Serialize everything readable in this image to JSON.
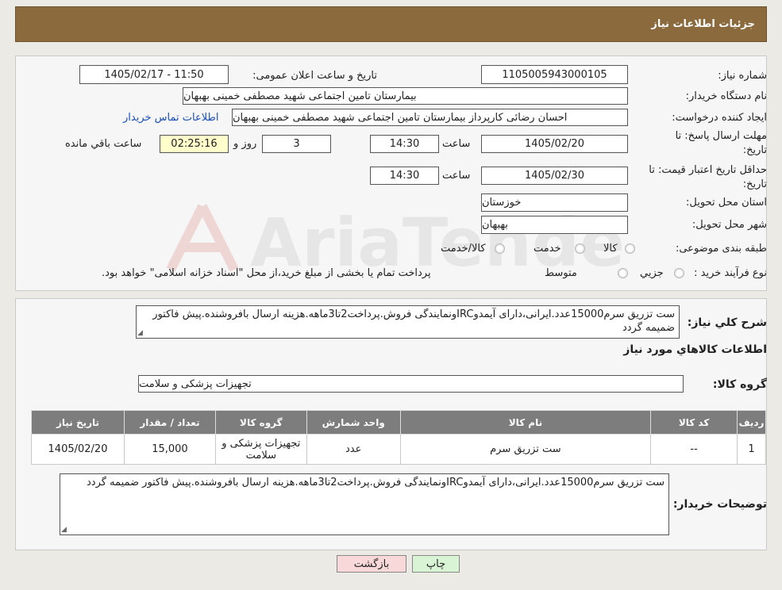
{
  "header": {
    "title": "جزئیات اطلاعات نیاز"
  },
  "form": {
    "need_number_label": "شماره نیاز:",
    "need_number": "1105005943000105",
    "announce_label": "تاریخ و ساعت اعلان عمومی:",
    "announce_value": "1405/02/17 - 11:50",
    "buyer_org_label": "نام دستگاه خریدار:",
    "buyer_org": "بیمارستان تامین اجتماعی شهید مصطفی خمینی بهبهان",
    "creator_label": "ایجاد کننده درخواست:",
    "creator": "احسان رضائی کارپرداز بیمارستان تامین اجتماعی شهید مصطفی خمینی بهبهان",
    "contact_link": "اطلاعات تماس خریدار",
    "deadline_label_1": "مهلت ارسال پاسخ: تا",
    "deadline_label_2": "تاریخ:",
    "deadline_date": "1405/02/20",
    "time_label": "ساعت",
    "deadline_time": "14:30",
    "days_value": "3",
    "days_label": "روز و",
    "remaining_time": "02:25:16",
    "remaining_label": "ساعت باقي مانده",
    "validity_label_1": "حداقل تاریخ اعتبار قیمت: تا",
    "validity_label_2": "تاریخ:",
    "validity_date": "1405/02/30",
    "validity_time": "14:30",
    "province_label": "استان محل تحویل:",
    "province": "خوزستان",
    "city_label": "شهر محل تحویل:",
    "city": "بهبهان",
    "category_label": "طبقه بندی موضوعی:",
    "category_options": [
      "کالا",
      "خدمت",
      "کالا/خدمت"
    ],
    "process_label": "نوع فرآیند خرید :",
    "process_options": [
      "جزیي",
      "متوسط"
    ],
    "process_note": "پرداخت تمام یا بخشی از مبلغ خرید،از محل \"اسناد خزانه اسلامی\" خواهد بود."
  },
  "summary": {
    "label": "شرح کلي نیاز:",
    "text": "ست تزریق سرم15000عدد.ایرانی،دارای آیمدوIRCونمایندگی فروش.پرداخت2تا3ماهه.هزینه ارسال بافروشنده.پیش فاکتور ضمیمه گردد",
    "items_title": "اطلاعات کالاهاي مورد نیاز",
    "group_label": "گروه کالا:",
    "group_value": "تجهیزات پزشکی و سلامت"
  },
  "table": {
    "headers": [
      "ردیف",
      "کد کالا",
      "نام کالا",
      "واحد شمارش",
      "گروه کالا",
      "تعداد / مقدار",
      "تاریخ نیاز"
    ],
    "rows": [
      [
        "1",
        "--",
        "ست تزریق سرم",
        "عدد",
        "تجهیزات پزشکی و سلامت",
        "15,000",
        "1405/02/20"
      ]
    ]
  },
  "buyer_notes": {
    "label": "توضیحات خریدار:",
    "text": "ست تزریق سرم15000عدد.ایرانی،دارای آیمدوIRCونمایندگی فروش.پرداخت2تا3ماهه.هزینه ارسال بافروشنده.پیش فاکتور ضمیمه گردد"
  },
  "buttons": {
    "print": "چاپ",
    "back": "بازگشت"
  },
  "watermark": {
    "text": "AriaTender.neT"
  },
  "colors": {
    "header_bg": "#8b6a3e",
    "table_header_bg": "#7d7d7d",
    "link": "#1a4fb5",
    "back_button": "#f8d8d8",
    "print_button": "#d9f4d4"
  }
}
